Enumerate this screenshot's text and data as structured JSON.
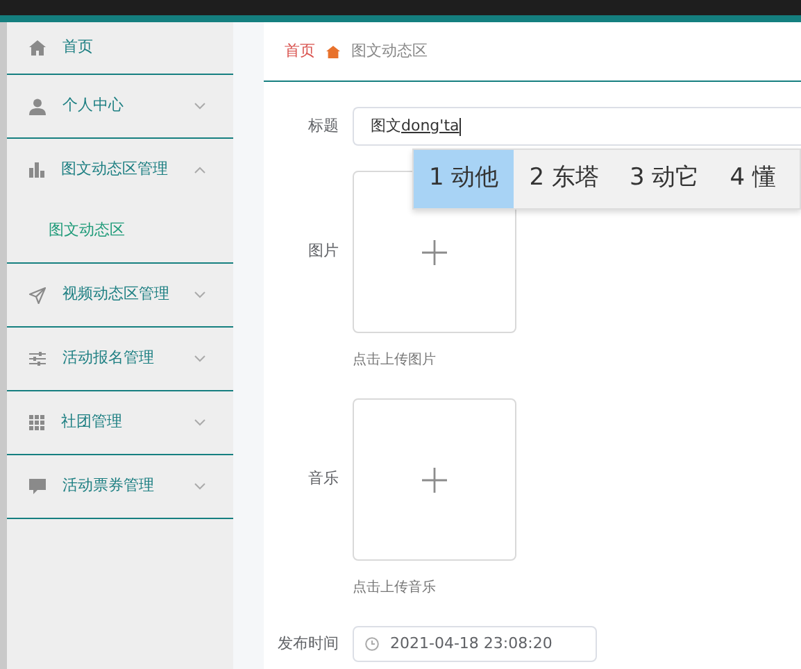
{
  "sidebar": {
    "items": [
      {
        "label": "首页",
        "kind": "link"
      },
      {
        "label": "个人中心",
        "kind": "menu",
        "expanded": false
      },
      {
        "label": "图文动态区管理",
        "kind": "menu",
        "expanded": true,
        "children": [
          {
            "label": "图文动态区",
            "selected": true
          }
        ]
      },
      {
        "label": "视频动态区管理",
        "kind": "menu",
        "expanded": false
      },
      {
        "label": "活动报名管理",
        "kind": "menu",
        "expanded": false
      },
      {
        "label": "社团管理",
        "kind": "menu",
        "expanded": false
      },
      {
        "label": "活动票券管理",
        "kind": "menu",
        "expanded": false
      }
    ]
  },
  "breadcrumb": [
    {
      "label": "首页",
      "kind": "link"
    },
    {
      "label": "图文动态区",
      "kind": "current"
    }
  ],
  "form": {
    "fields": [
      {
        "kind": "text",
        "label": "标题",
        "value": "图文",
        "composition": "dong'ta"
      },
      {
        "kind": "upload",
        "label": "图片",
        "hint": "点击上传图片"
      },
      {
        "kind": "upload",
        "label": "音乐",
        "hint": "点击上传音乐"
      },
      {
        "kind": "datetime",
        "label": "发布时间",
        "value": "2021-04-18 23:08:20"
      }
    ]
  },
  "ime": {
    "candidates": [
      {
        "label": "1 动他",
        "selected": true
      },
      {
        "label": "2 东塔",
        "selected": false
      },
      {
        "label": "3 动它",
        "selected": false
      },
      {
        "label": "4 懂",
        "selected": false
      }
    ]
  }
}
